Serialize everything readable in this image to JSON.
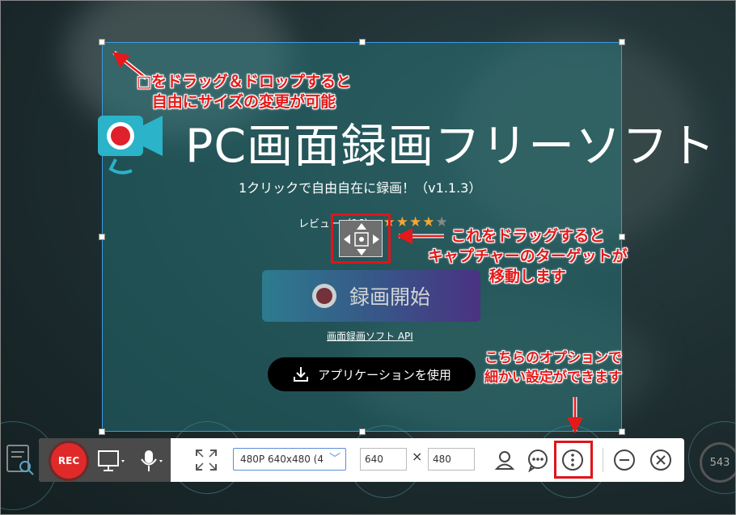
{
  "brand": {
    "title": "PC画面録画フリーソフト",
    "tagline": "1クリックで自由自在に録画！（v1.1.3）",
    "review_label": "レビュー（96）",
    "rating_stars": 4.5,
    "logo_icon": "camera-icon",
    "logo_color": "#2ab3c9"
  },
  "main": {
    "record_start_label": "録画開始",
    "api_link_label": "画面録画ソフト API",
    "app_button_label": "アプリケーションを使用"
  },
  "annotations": {
    "resize_note": [
      "□をドラッグ＆ドロップすると",
      "自由にサイズの変更が可能"
    ],
    "drag_note": [
      "これをドラッグすると",
      "キャプチャーのターゲットが",
      "移動します"
    ],
    "options_note": [
      "こちらのオプションで",
      "細かい設定ができます"
    ],
    "note_color": "#e51919"
  },
  "toolbar": {
    "rec_label": "REC",
    "preset_value": "480P 640x480 (4",
    "width_value": "640",
    "times_symbol": "×",
    "height_value": "480",
    "rec_color": "#e02a2a"
  },
  "side": {
    "counter_value": "543"
  }
}
